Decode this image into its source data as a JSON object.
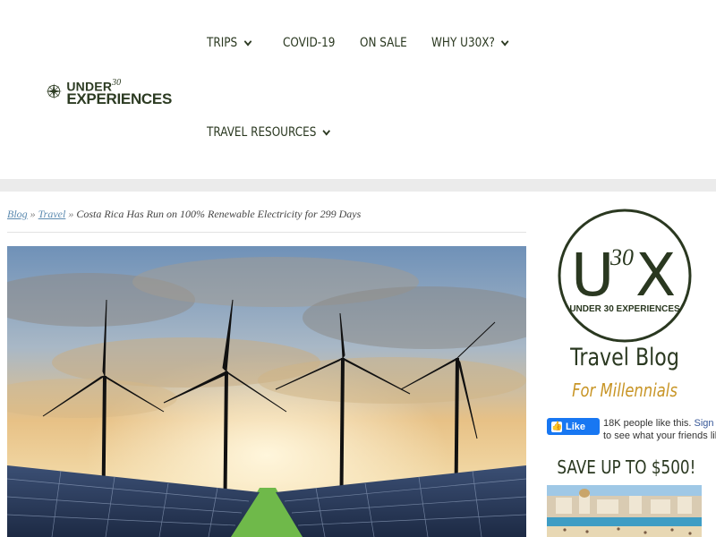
{
  "header": {
    "logo": {
      "line1": "UNDER",
      "superscript": "30",
      "line2": "EXPERIENCES"
    },
    "nav": [
      {
        "label": "TRIPS",
        "has_dropdown": true
      },
      {
        "label": "COVID-19",
        "has_dropdown": false
      },
      {
        "label": "ON SALE",
        "has_dropdown": false
      },
      {
        "label": "WHY U30X?",
        "has_dropdown": true
      },
      {
        "label": "TRAVEL RESOURCES",
        "has_dropdown": true
      }
    ]
  },
  "breadcrumb": {
    "items": [
      {
        "label": "Blog"
      },
      {
        "label": "Travel"
      }
    ],
    "separator": "»",
    "current": "Costa Rica Has Run on 100% Renewable Electricity for 299 Days"
  },
  "sidebar": {
    "badge": {
      "letters": "U",
      "superscript": "30",
      "letter2": "X",
      "caption": "UNDER 30 EXPERIENCES"
    },
    "title": "Travel Blog",
    "subtitle": "For Millennials",
    "facebook": {
      "like_label": "Like",
      "count_text": "18K people like this.",
      "signup_link": "Sign Up",
      "tail_text": "to see what your friends like."
    },
    "promo_heading": "SAVE UP TO $500!"
  },
  "colors": {
    "brand_green": "#2a3820",
    "accent_gold": "#c89526",
    "link_blue": "#5d8bb0",
    "facebook_blue": "#1877f2"
  }
}
